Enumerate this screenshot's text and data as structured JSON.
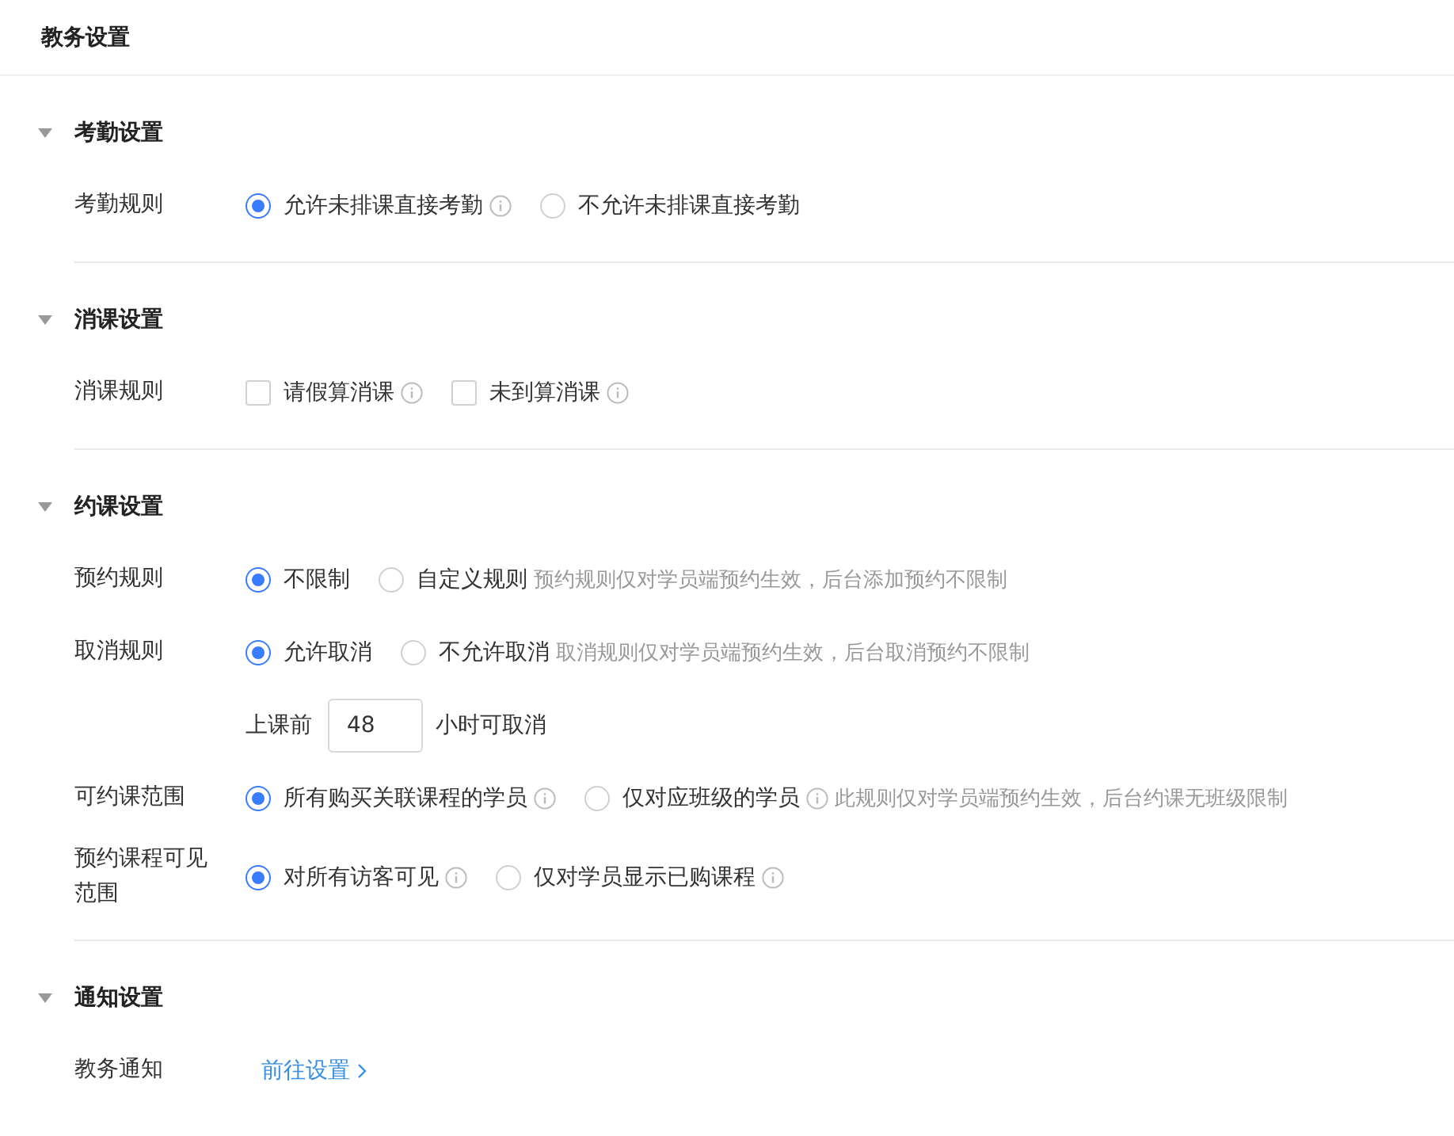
{
  "page": {
    "title": "教务设置"
  },
  "sections": [
    {
      "title": "考勤设置",
      "expanded": true,
      "rows": [
        {
          "kind": "radio",
          "label": "考勤规则",
          "options": [
            {
              "label": "允许未排课直接考勤",
              "selected": true,
              "info": true
            },
            {
              "label": "不允许未排课直接考勤",
              "selected": false,
              "info": false
            }
          ]
        }
      ]
    },
    {
      "title": "消课设置",
      "expanded": true,
      "rows": [
        {
          "kind": "checkbox",
          "label": "消课规则",
          "options": [
            {
              "label": "请假算消课",
              "checked": false,
              "info": true
            },
            {
              "label": "未到算消课",
              "checked": false,
              "info": true
            }
          ]
        }
      ]
    },
    {
      "title": "约课设置",
      "expanded": true,
      "rows": [
        {
          "kind": "radio",
          "label": "预约规则",
          "options": [
            {
              "label": "不限制",
              "selected": true,
              "info": false
            },
            {
              "label": "自定义规则",
              "selected": false,
              "info": false
            }
          ],
          "note": "预约规则仅对学员端预约生效，后台添加预约不限制"
        },
        {
          "kind": "radio",
          "label": "取消规则",
          "options": [
            {
              "label": "允许取消",
              "selected": true,
              "info": false
            },
            {
              "label": "不允许取消",
              "selected": false,
              "info": false
            }
          ],
          "note": "取消规则仅对学员端预约生效，后台取消预约不限制"
        },
        {
          "kind": "hours",
          "prefix": "上课前",
          "value": "48",
          "suffix": "小时可取消"
        },
        {
          "kind": "radio",
          "label": "可约课范围",
          "options": [
            {
              "label": "所有购买关联课程的学员",
              "selected": true,
              "info": true
            },
            {
              "label": "仅对应班级的学员",
              "selected": false,
              "info": true
            }
          ],
          "note": "此规则仅对学员端预约生效，后台约课无班级限制"
        },
        {
          "kind": "radio",
          "label": "预约课程可见范围",
          "options": [
            {
              "label": "对所有访客可见",
              "selected": true,
              "info": true
            },
            {
              "label": "仅对学员显示已购课程",
              "selected": false,
              "info": true
            }
          ]
        }
      ]
    },
    {
      "title": "通知设置",
      "expanded": true,
      "rows": [
        {
          "kind": "link",
          "label": "教务通知",
          "link": "前往设置"
        }
      ]
    }
  ]
}
